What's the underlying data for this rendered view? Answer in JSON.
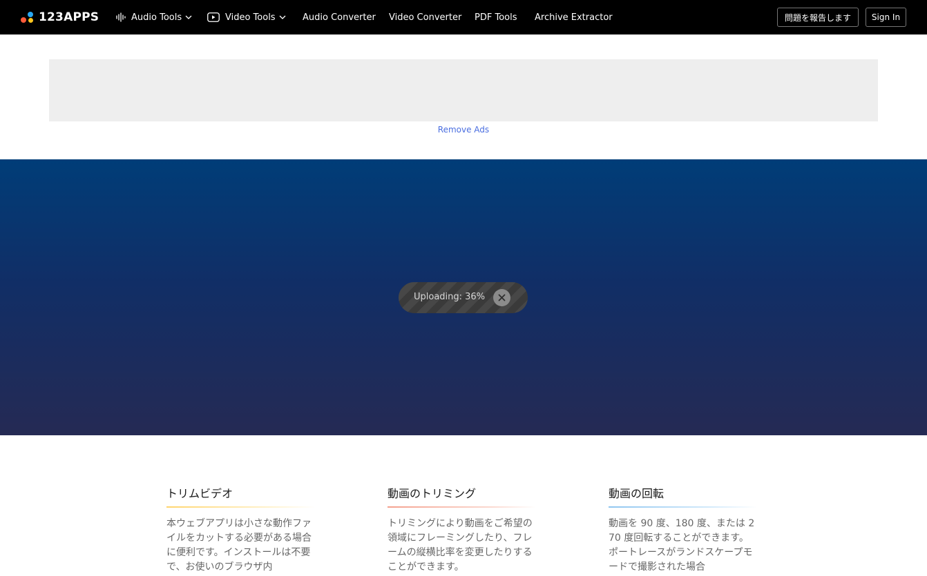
{
  "header": {
    "logo_text": "123APPS",
    "nav": [
      {
        "label": "Audio Tools",
        "icon": "audio-wave-icon",
        "dropdown": true
      },
      {
        "label": "Video Tools",
        "icon": "play-icon",
        "dropdown": true
      },
      {
        "label": "Audio Converter"
      },
      {
        "label": "Video Converter"
      },
      {
        "label": "PDF Tools"
      },
      {
        "label": "Archive Extractor"
      }
    ],
    "report_issue_label": "問題を報告します",
    "sign_in_label": "Sign In"
  },
  "ad": {
    "remove_ads_label": "Remove Ads"
  },
  "upload": {
    "status_text": "Uploading: 36%",
    "progress_percent": 36
  },
  "features": [
    {
      "title": "トリムビデオ",
      "text": "本ウェブアプリは小さな動作ファイルをカットする必要がある場合に便利です。インストールは不要で、お使いのブラウザ内"
    },
    {
      "title": "動画のトリミング",
      "text": "トリミングにより動画をご希望の領域にフレーミングしたり、フレームの縦横比率を変更したりすることができます。"
    },
    {
      "title": "動画の回転",
      "text": "動画を 90 度、180 度、または 270 度回転することができます。ポートレースがランドスケープモードで撮影された場合"
    }
  ],
  "colors": {
    "header_bg": "#000000",
    "link_blue": "#4a6ee0",
    "stage_top": "#003d78",
    "stage_bottom": "#252a54",
    "logo_blue": "#2aa8f2",
    "logo_orange": "#ff5b3a",
    "logo_yellow": "#ffc61e"
  }
}
